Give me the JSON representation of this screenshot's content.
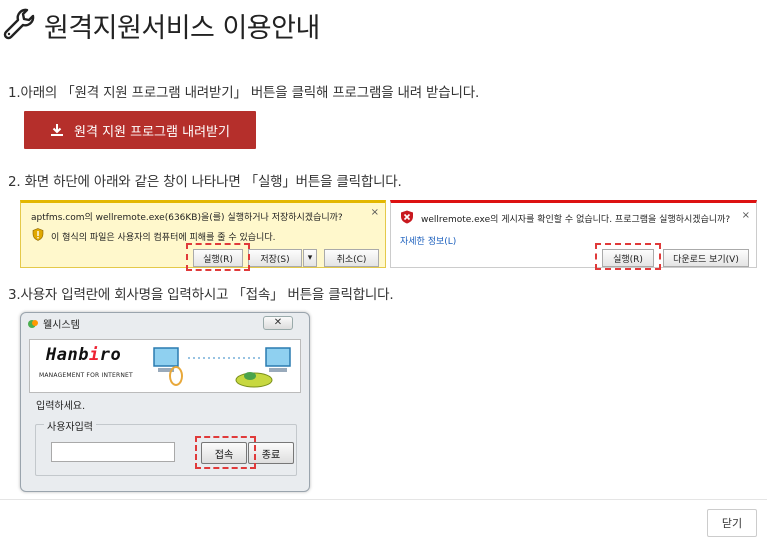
{
  "header": {
    "title": "원격지원서비스 이용안내",
    "icon": "wrench-icon"
  },
  "steps": {
    "step1": "1.아래의 「원격 지원 프로그램 내려받기」 버튼을 클릭해 프로그램을 내려 받습니다.",
    "step2": "2. 화면 하단에 아래와 같은 창이 나타나면 「실행」버튼을 클릭합니다.",
    "step3": "3.사용자 입력란에 회사명을 입력하시고 「접속」 버튼을 클릭합니다."
  },
  "download_button": {
    "label": "원격 지원 프로그램 내려받기",
    "icon": "download-icon",
    "color": "#b52f2b"
  },
  "ie_bar": {
    "line1": "aptfms.com의 wellremote.exe(636KB)을(를) 실행하거나 저장하시겠습니까?",
    "line2": "이 형식의 파일은 사용자의 컴퓨터에 피해를 줄 수 있습니다.",
    "run": "실행(R)",
    "save": "저장(S)",
    "dropdown": "▾",
    "cancel": "취소(C)",
    "close": "×"
  },
  "warn_bar": {
    "line1": "wellremote.exe의 게시자를 확인할 수 없습니다. 프로그램을 실행하시겠습니까?",
    "link": "자세한 정보(L)",
    "run": "실행(R)",
    "view": "다운로드 보기(V)",
    "close": "×"
  },
  "dialog": {
    "title": "웰시스템",
    "close": "✕",
    "brand_pre": "Hanb",
    "brand_i": "i",
    "brand_post": "ro",
    "tagline": "MANAGEMENT FOR INTERNET",
    "prompt": "입력하세요.",
    "legend": "사용자입력",
    "input_value": "",
    "connect": "접속",
    "exit": "종료"
  },
  "footer": {
    "close": "닫기"
  },
  "colors": {
    "highlight": "#e03a3a",
    "accent": "#b52f2b"
  }
}
